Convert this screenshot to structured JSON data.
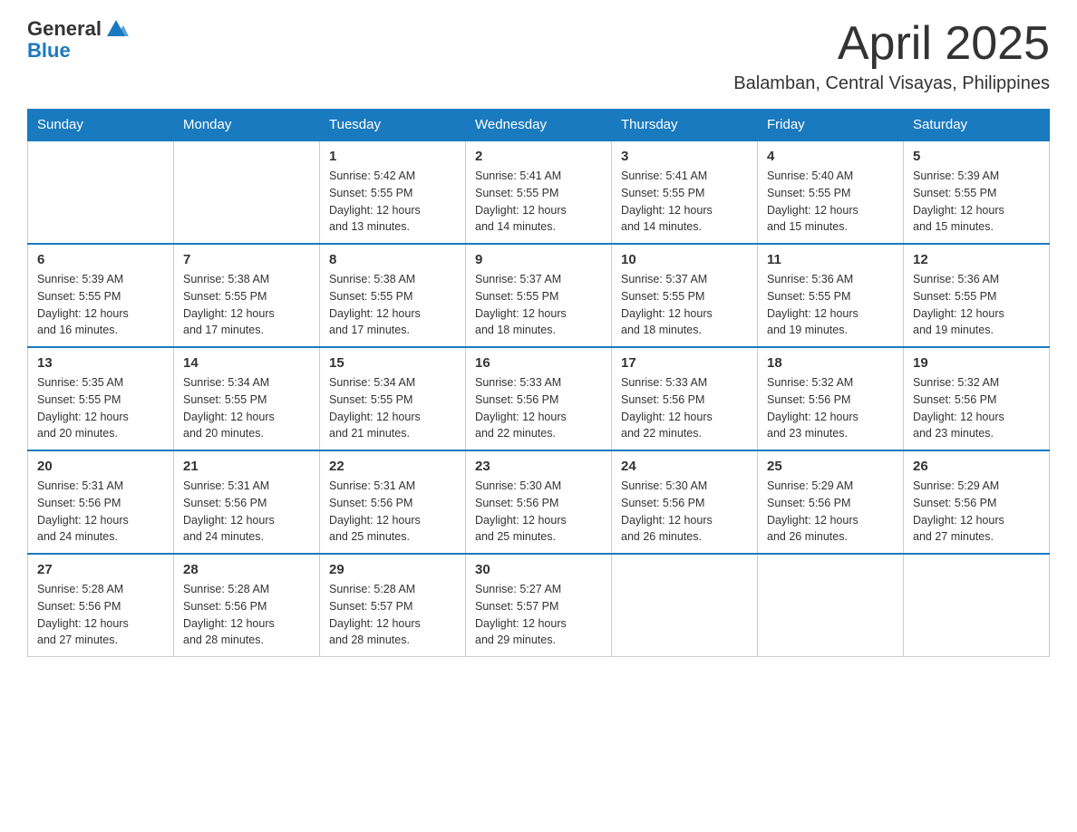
{
  "header": {
    "logo_general": "General",
    "logo_blue": "Blue",
    "title": "April 2025",
    "subtitle": "Balamban, Central Visayas, Philippines"
  },
  "weekdays": [
    "Sunday",
    "Monday",
    "Tuesday",
    "Wednesday",
    "Thursday",
    "Friday",
    "Saturday"
  ],
  "weeks": [
    [
      {
        "day": "",
        "info": ""
      },
      {
        "day": "",
        "info": ""
      },
      {
        "day": "1",
        "info": "Sunrise: 5:42 AM\nSunset: 5:55 PM\nDaylight: 12 hours\nand 13 minutes."
      },
      {
        "day": "2",
        "info": "Sunrise: 5:41 AM\nSunset: 5:55 PM\nDaylight: 12 hours\nand 14 minutes."
      },
      {
        "day": "3",
        "info": "Sunrise: 5:41 AM\nSunset: 5:55 PM\nDaylight: 12 hours\nand 14 minutes."
      },
      {
        "day": "4",
        "info": "Sunrise: 5:40 AM\nSunset: 5:55 PM\nDaylight: 12 hours\nand 15 minutes."
      },
      {
        "day": "5",
        "info": "Sunrise: 5:39 AM\nSunset: 5:55 PM\nDaylight: 12 hours\nand 15 minutes."
      }
    ],
    [
      {
        "day": "6",
        "info": "Sunrise: 5:39 AM\nSunset: 5:55 PM\nDaylight: 12 hours\nand 16 minutes."
      },
      {
        "day": "7",
        "info": "Sunrise: 5:38 AM\nSunset: 5:55 PM\nDaylight: 12 hours\nand 17 minutes."
      },
      {
        "day": "8",
        "info": "Sunrise: 5:38 AM\nSunset: 5:55 PM\nDaylight: 12 hours\nand 17 minutes."
      },
      {
        "day": "9",
        "info": "Sunrise: 5:37 AM\nSunset: 5:55 PM\nDaylight: 12 hours\nand 18 minutes."
      },
      {
        "day": "10",
        "info": "Sunrise: 5:37 AM\nSunset: 5:55 PM\nDaylight: 12 hours\nand 18 minutes."
      },
      {
        "day": "11",
        "info": "Sunrise: 5:36 AM\nSunset: 5:55 PM\nDaylight: 12 hours\nand 19 minutes."
      },
      {
        "day": "12",
        "info": "Sunrise: 5:36 AM\nSunset: 5:55 PM\nDaylight: 12 hours\nand 19 minutes."
      }
    ],
    [
      {
        "day": "13",
        "info": "Sunrise: 5:35 AM\nSunset: 5:55 PM\nDaylight: 12 hours\nand 20 minutes."
      },
      {
        "day": "14",
        "info": "Sunrise: 5:34 AM\nSunset: 5:55 PM\nDaylight: 12 hours\nand 20 minutes."
      },
      {
        "day": "15",
        "info": "Sunrise: 5:34 AM\nSunset: 5:55 PM\nDaylight: 12 hours\nand 21 minutes."
      },
      {
        "day": "16",
        "info": "Sunrise: 5:33 AM\nSunset: 5:56 PM\nDaylight: 12 hours\nand 22 minutes."
      },
      {
        "day": "17",
        "info": "Sunrise: 5:33 AM\nSunset: 5:56 PM\nDaylight: 12 hours\nand 22 minutes."
      },
      {
        "day": "18",
        "info": "Sunrise: 5:32 AM\nSunset: 5:56 PM\nDaylight: 12 hours\nand 23 minutes."
      },
      {
        "day": "19",
        "info": "Sunrise: 5:32 AM\nSunset: 5:56 PM\nDaylight: 12 hours\nand 23 minutes."
      }
    ],
    [
      {
        "day": "20",
        "info": "Sunrise: 5:31 AM\nSunset: 5:56 PM\nDaylight: 12 hours\nand 24 minutes."
      },
      {
        "day": "21",
        "info": "Sunrise: 5:31 AM\nSunset: 5:56 PM\nDaylight: 12 hours\nand 24 minutes."
      },
      {
        "day": "22",
        "info": "Sunrise: 5:31 AM\nSunset: 5:56 PM\nDaylight: 12 hours\nand 25 minutes."
      },
      {
        "day": "23",
        "info": "Sunrise: 5:30 AM\nSunset: 5:56 PM\nDaylight: 12 hours\nand 25 minutes."
      },
      {
        "day": "24",
        "info": "Sunrise: 5:30 AM\nSunset: 5:56 PM\nDaylight: 12 hours\nand 26 minutes."
      },
      {
        "day": "25",
        "info": "Sunrise: 5:29 AM\nSunset: 5:56 PM\nDaylight: 12 hours\nand 26 minutes."
      },
      {
        "day": "26",
        "info": "Sunrise: 5:29 AM\nSunset: 5:56 PM\nDaylight: 12 hours\nand 27 minutes."
      }
    ],
    [
      {
        "day": "27",
        "info": "Sunrise: 5:28 AM\nSunset: 5:56 PM\nDaylight: 12 hours\nand 27 minutes."
      },
      {
        "day": "28",
        "info": "Sunrise: 5:28 AM\nSunset: 5:56 PM\nDaylight: 12 hours\nand 28 minutes."
      },
      {
        "day": "29",
        "info": "Sunrise: 5:28 AM\nSunset: 5:57 PM\nDaylight: 12 hours\nand 28 minutes."
      },
      {
        "day": "30",
        "info": "Sunrise: 5:27 AM\nSunset: 5:57 PM\nDaylight: 12 hours\nand 29 minutes."
      },
      {
        "day": "",
        "info": ""
      },
      {
        "day": "",
        "info": ""
      },
      {
        "day": "",
        "info": ""
      }
    ]
  ]
}
